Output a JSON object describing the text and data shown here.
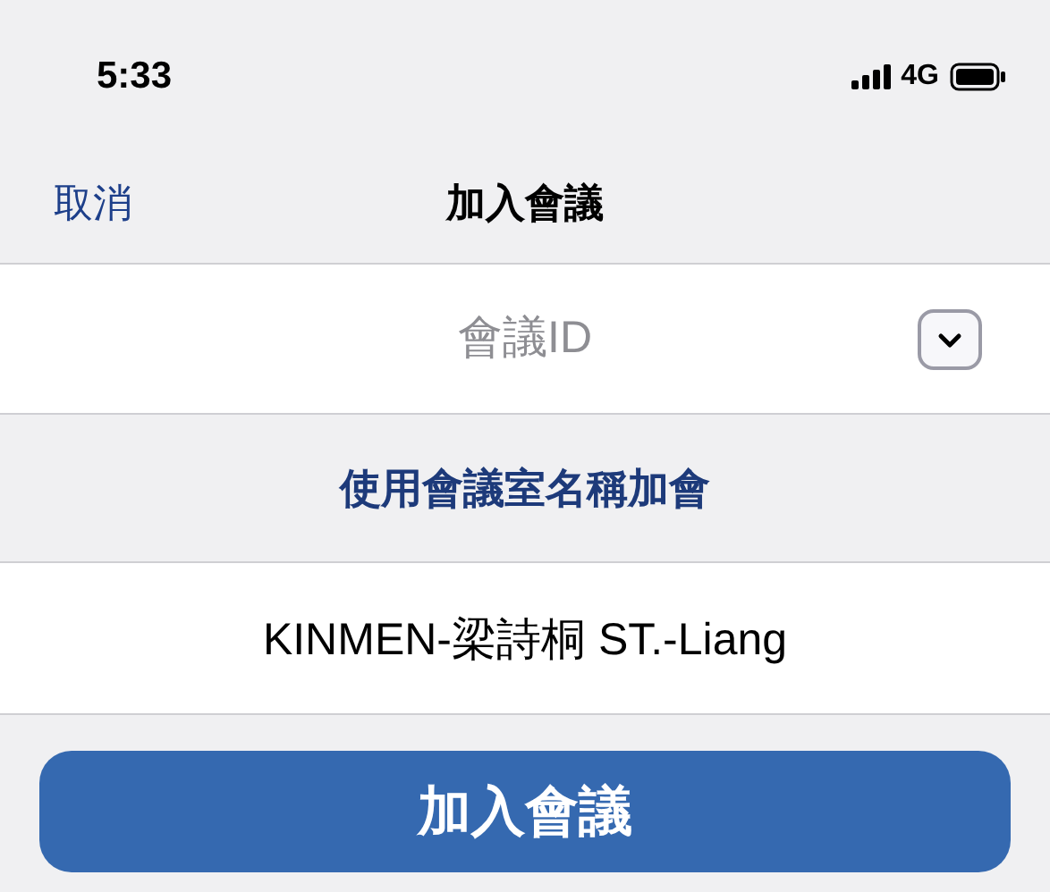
{
  "status_bar": {
    "time": "5:33",
    "network": "4G"
  },
  "nav": {
    "cancel": "取消",
    "title": "加入會議"
  },
  "meeting_id_field": {
    "placeholder": "會議ID"
  },
  "room_name_link": "使用會議室名稱加會",
  "display_name_field": {
    "value": "KINMEN-梁詩桐 ST.-Liang"
  },
  "join_button": "加入會議"
}
